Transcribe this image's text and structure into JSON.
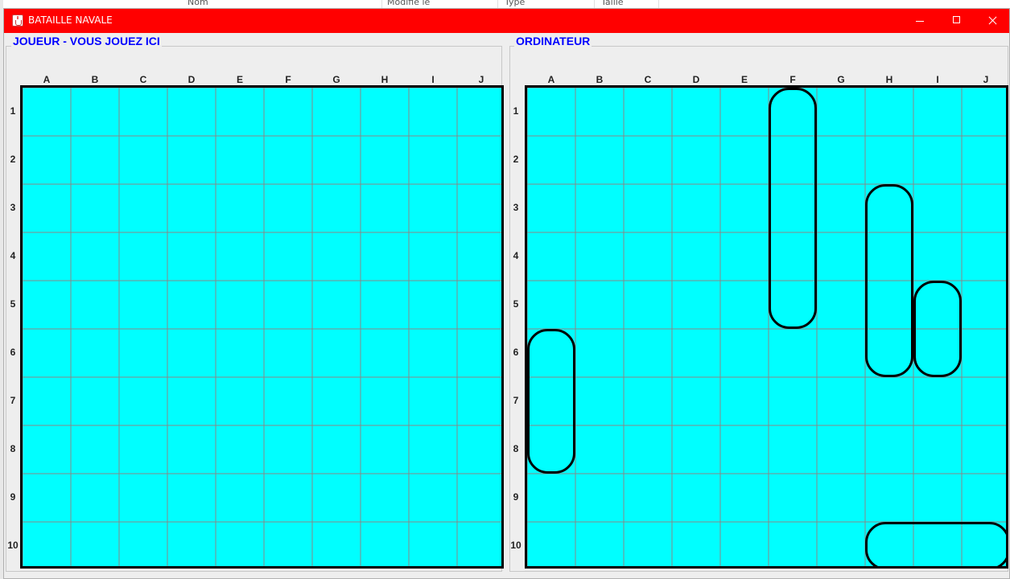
{
  "background": {
    "columns": [
      "Nom",
      "Modifié le",
      "Type",
      "Taille"
    ]
  },
  "window": {
    "title": "BATAILLE NAVALE",
    "controls": {
      "minimize": "minimize-icon",
      "maximize": "maximize-icon",
      "close": "close-icon"
    }
  },
  "player_panel": {
    "title": "JOUEUR - VOUS JOUEZ ICI"
  },
  "computer_panel": {
    "title": "ORDINATEUR"
  },
  "grid": {
    "columns": [
      "A",
      "B",
      "C",
      "D",
      "E",
      "F",
      "G",
      "H",
      "I",
      "J"
    ],
    "rows": [
      "1",
      "2",
      "3",
      "4",
      "5",
      "6",
      "7",
      "8",
      "9",
      "10"
    ],
    "water_color": "#00ffff",
    "line_color": "#888888"
  },
  "computer_ships": [
    {
      "col": "F",
      "row": 1,
      "orientation": "vertical",
      "length": 5
    },
    {
      "col": "H",
      "row": 3,
      "orientation": "vertical",
      "length": 4
    },
    {
      "col": "I",
      "row": 5,
      "orientation": "vertical",
      "length": 2
    },
    {
      "col": "A",
      "row": 6,
      "orientation": "vertical",
      "length": 3
    },
    {
      "col": "H",
      "row": 10,
      "orientation": "horizontal",
      "length": 3
    }
  ]
}
